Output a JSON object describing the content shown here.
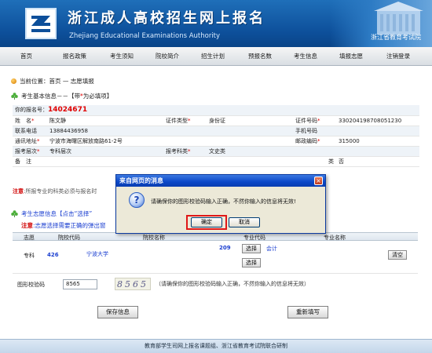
{
  "header": {
    "title": "浙江成人高校招生网上报名",
    "subtitle": "Zhejiang Educational Examinations Authority",
    "org": "浙江省教育考试院"
  },
  "nav": [
    "首页",
    "报名政策",
    "考生须知",
    "院校简介",
    "招生计划",
    "预报名数",
    "考生信息",
    "填报志愿",
    "注销登录"
  ],
  "breadcrumb": "当前位置：首页 — 志愿填报",
  "basic_section": {
    "title": "考生基本信息－－【带",
    "title_mark": "*",
    "title_tail": "为必填项】"
  },
  "info": {
    "appnum_label": "你的报名号：",
    "appnum": "14024671",
    "name_label": "姓　名",
    "name": "陈文静",
    "idtype_label": "证件类型",
    "idtype": "身份证",
    "idnum_label": "证件号码",
    "idnum": "330204198708051230",
    "phone_label": "联系电话",
    "phone": "13884436958",
    "mobile_label": "手机号码",
    "mobile": "",
    "address_label": "通讯地址",
    "address": "宁波市海曙区解放南路61-2号",
    "zip_label": "邮政编码",
    "zip": "315000",
    "level_label": "报考层次",
    "level": "专科层次",
    "subject_label": "报考科类",
    "subject": "文史类",
    "remark_label": "备　注",
    "extra_tail_label": "类",
    "extra_tail_value": "否"
  },
  "note1": {
    "label": "注意",
    "text": ":所报专业的科类必须与报名时"
  },
  "vol_section": {
    "title": "考生志愿信息【点击“选择”",
    "note_label": "注意",
    "note_text": ":志愿选择需要正确的弹出窗"
  },
  "vol_table": {
    "headers": [
      "志愿",
      "院校代码",
      "院校名称",
      "专业代码",
      "专业名称"
    ],
    "row": {
      "level": "专科",
      "school_code": "426",
      "school_name": "宁波大学",
      "major_code": "209",
      "choose1": "选择",
      "major_name": "会计",
      "choose2": "选择",
      "clear": "清空"
    }
  },
  "captcha": {
    "label": "图形校验码",
    "value": "8565",
    "image_text": "8565",
    "note": "（请确保你的图形校验码输入正确，不然你输入的信息将无效）"
  },
  "buttons": {
    "save": "保存信息",
    "reset": "重新填写"
  },
  "footer": "教育部学生司网上报名课题组、浙江省教育考试院联合研制",
  "dialog": {
    "title": "来自网页的消息",
    "message": "请确保你的图形校验码输入正确，不然你输入的信息将无效!",
    "ok": "确定",
    "cancel": "取消",
    "close": "×",
    "icon": "?"
  }
}
